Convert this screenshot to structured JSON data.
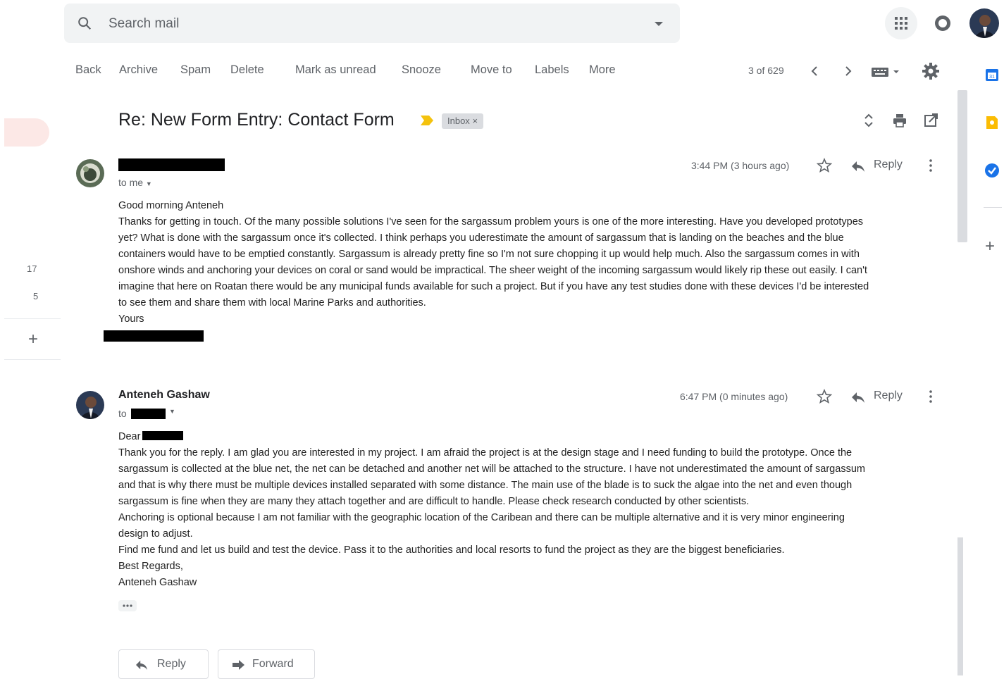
{
  "search": {
    "placeholder": "Search mail"
  },
  "toolbar": {
    "back": "Back",
    "archive": "Archive",
    "spam": "Spam",
    "delete": "Delete",
    "mark_unread": "Mark as unread",
    "snooze": "Snooze",
    "move_to": "Move to",
    "labels": "Labels",
    "more": "More"
  },
  "pager": {
    "text": "3 of 629"
  },
  "thread": {
    "subject": "Re: New Form Entry: Contact Form",
    "label_chip": "Inbox",
    "chip_close": "×"
  },
  "leftnav": {
    "count_a": "17",
    "count_b": "5"
  },
  "messages": [
    {
      "to": "to me",
      "time": "3:44 PM (3 hours ago)",
      "reply_label": "Reply",
      "lines": [
        "Good morning Anteneh",
        "Thanks for getting in touch. Of the many possible solutions I've seen for the sargassum problem yours is one of the more interesting. Have you developed prototypes",
        "yet? What is done with the sargassum once it's collected. I think perhaps you uderestimate the amount of sargassum that is landing on the beaches and the blue",
        "containers would have to be emptied constantly. Sargassum is already pretty fine so I'm not sure chopping it up would help much. Also the sargassum comes in with",
        "onshore winds and anchoring your devices on coral or sand would be impractical. The sheer weight of the incoming sargassum would likely rip these out easily. I can't",
        "imagine that here on Roatan there would be any municipal funds available for such a project. But if you have any test studies done with these devices I'd be interested",
        "to see them and share them with local Marine Parks and authorities.",
        "Yours"
      ]
    },
    {
      "sender": "Anteneh Gashaw",
      "to": "to",
      "time": "6:47 PM (0 minutes ago)",
      "reply_label": "Reply",
      "greeting": "Dear",
      "lines": [
        "Thank you for the reply. I am glad you are interested in my project. I am afraid the project is at the design stage and I need funding to build the prototype. Once the",
        "sargassum is collected at the blue net, the net can be detached and another net will be attached to the structure. I have not underestimated the amount of sargassum",
        "and that is why there must be multiple devices installed separated with some distance. The main use of the blade is to suck the algae into the net and even though",
        "sargassum is fine when they are many they attach together and are difficult to handle. Please check research conducted by other scientists.",
        "Anchoring is optional because I am not familiar with the geographic location of the Caribean and there can be multiple alternative and it is very minor engineering",
        "design to adjust.",
        "Find me fund and let us build and test the device. Pass it to the authorities and local resorts to fund the project as they are the biggest beneficiaries.",
        "Best Regards,",
        "Anteneh Gashaw"
      ]
    }
  ],
  "footer": {
    "reply": "Reply",
    "forward": "Forward"
  },
  "colors": {
    "accent_yellow": "#f4c20d",
    "side_blue": "#1a73e8",
    "side_yellow": "#fbbc04"
  }
}
